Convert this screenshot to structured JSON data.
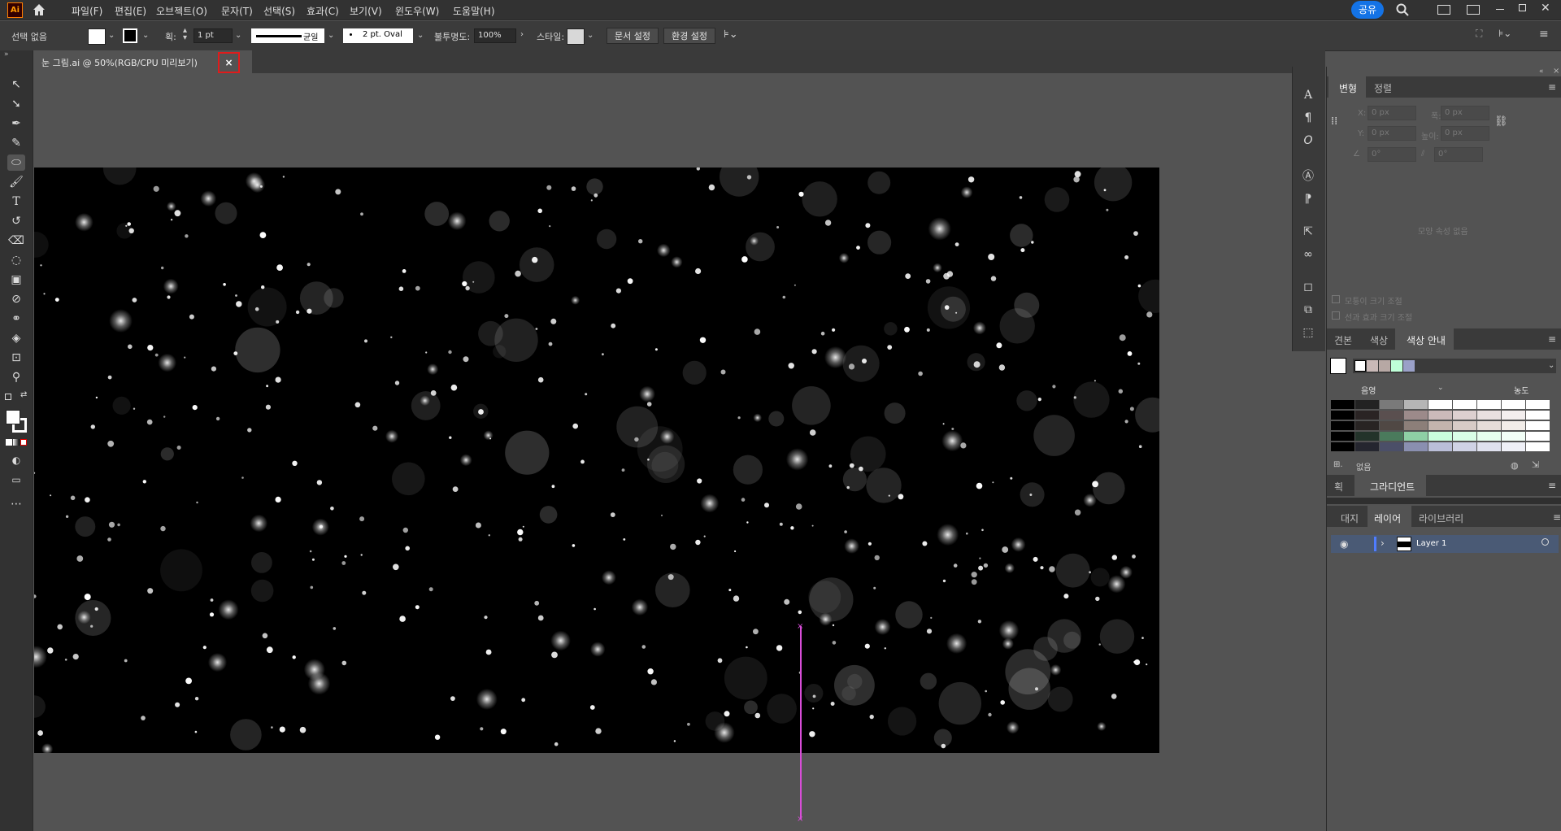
{
  "app": {
    "logo": "Ai"
  },
  "menu": [
    "파일(F)",
    "편집(E)",
    "오브젝트(O)",
    "문자(T)",
    "선택(S)",
    "효과(C)",
    "보기(V)",
    "윈도우(W)",
    "도움말(H)"
  ],
  "share_label": "공유",
  "control": {
    "selection": "선택 없음",
    "stroke_label": "획:",
    "stroke_value": "1 pt",
    "profile_label": "균일",
    "brush_label": "2 pt. Oval",
    "opacity_label": "불투명도:",
    "opacity_value": "100%",
    "style_label": "스타일:",
    "doc_setup": "문서 설정",
    "preferences": "환경 설정"
  },
  "document": {
    "tab_title": "눈 그림.ai @ 50%(RGB/CPU 미리보기)",
    "close": "×"
  },
  "transform_panel": {
    "tabs": [
      "변형",
      "정렬"
    ],
    "x_label": "X:",
    "x_value": "0 px",
    "y_label": "Y:",
    "y_value": "0 px",
    "w_label": "폭:",
    "w_value": "0 px",
    "h_label": "높이:",
    "h_value": "0 px",
    "angle_value": "0°",
    "shear_value": "0°",
    "empty_message": "모양 속성 없음",
    "scale_corners": "모퉁이 크기 조절",
    "scale_strokes": "선과 효과 크기 조절"
  },
  "color_panel": {
    "tabs": [
      "견본",
      "색상",
      "색상 안내"
    ],
    "shade_label": "음영",
    "tint_label": "농도",
    "footer": "없음"
  },
  "gradient_panel": {
    "tabs": [
      "획",
      "그라디언트"
    ]
  },
  "layers_panel": {
    "tabs": [
      "대지",
      "레이어",
      "라이브러리"
    ],
    "layer_name": "Layer 1"
  },
  "colors": {
    "accent": "#1473e6",
    "path": "#d84dd8",
    "close_highlight": "#e01b1b",
    "layer_highlight": "#4a5a75"
  }
}
